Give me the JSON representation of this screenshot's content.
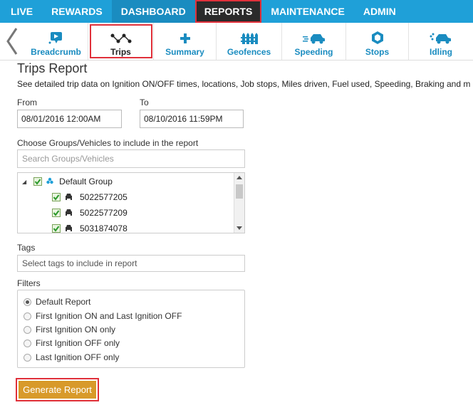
{
  "nav": {
    "items": [
      {
        "label": "LIVE"
      },
      {
        "label": "REWARDS"
      },
      {
        "label": "DASHBOARD"
      },
      {
        "label": "REPORTS"
      },
      {
        "label": "MAINTENANCE"
      },
      {
        "label": "ADMIN"
      }
    ],
    "selected": "REPORTS"
  },
  "toolbar": {
    "items": [
      {
        "label": "Breadcrumb",
        "icon": "breadcrumb-icon"
      },
      {
        "label": "Trips",
        "icon": "trips-icon"
      },
      {
        "label": "Summary",
        "icon": "plus-icon"
      },
      {
        "label": "Geofences",
        "icon": "fence-icon"
      },
      {
        "label": "Speeding",
        "icon": "speeding-car-icon"
      },
      {
        "label": "Stops",
        "icon": "stop-hexagon-icon"
      },
      {
        "label": "Idling",
        "icon": "idling-car-icon"
      }
    ],
    "selected": "Trips",
    "colors": {
      "accent": "#1a8cc0",
      "highlight": "#e0303a"
    }
  },
  "report": {
    "title": "Trips Report",
    "description": "See detailed trip data on Ignition ON/OFF times, locations, Job stops, Miles driven, Fuel used, Speeding, Braking and m",
    "from_label": "From",
    "from_value": "08/01/2016 12:00AM",
    "to_label": "To",
    "to_value": "08/10/2016 11:59PM",
    "groups_label": "Choose Groups/Vehicles to include in the report",
    "groups_placeholder": "Search Groups/Vehicles",
    "tree": {
      "group": "Default Group",
      "vehicles": [
        "5022577205",
        "5022577209",
        "5031874078"
      ]
    },
    "tags_label": "Tags",
    "tags_placeholder": "Select tags to include in report",
    "filters_label": "Filters",
    "filters": [
      {
        "label": "Default Report",
        "checked": true
      },
      {
        "label": "First Ignition ON and Last Ignition OFF",
        "checked": false
      },
      {
        "label": "First Ignition ON only",
        "checked": false
      },
      {
        "label": "First Ignition OFF only",
        "checked": false
      },
      {
        "label": "Last Ignition OFF only",
        "checked": false
      }
    ],
    "generate_label": "Generate Report",
    "button_color": "#d89a2a"
  }
}
